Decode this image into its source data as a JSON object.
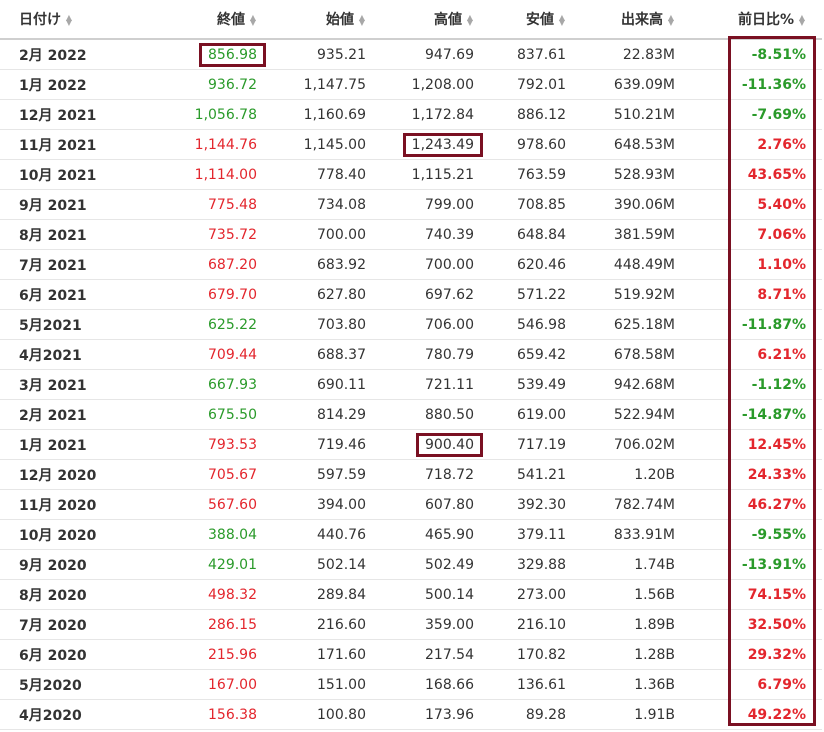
{
  "table": {
    "headers": {
      "date": "日付け",
      "close": "終値",
      "open": "始値",
      "high": "高値",
      "low": "安値",
      "volume": "出来高",
      "change": "前日比%"
    },
    "rows": [
      {
        "date": "2月 2022",
        "close": "856.98",
        "open": "935.21",
        "high": "947.69",
        "low": "837.61",
        "volume": "22.83M",
        "change": "-8.51%",
        "dir": "down"
      },
      {
        "date": "1月 2022",
        "close": "936.72",
        "open": "1,147.75",
        "high": "1,208.00",
        "low": "792.01",
        "volume": "639.09M",
        "change": "-11.36%",
        "dir": "down"
      },
      {
        "date": "12月 2021",
        "close": "1,056.78",
        "open": "1,160.69",
        "high": "1,172.84",
        "low": "886.12",
        "volume": "510.21M",
        "change": "-7.69%",
        "dir": "down"
      },
      {
        "date": "11月 2021",
        "close": "1,144.76",
        "open": "1,145.00",
        "high": "1,243.49",
        "low": "978.60",
        "volume": "648.53M",
        "change": "2.76%",
        "dir": "up"
      },
      {
        "date": "10月 2021",
        "close": "1,114.00",
        "open": "778.40",
        "high": "1,115.21",
        "low": "763.59",
        "volume": "528.93M",
        "change": "43.65%",
        "dir": "up"
      },
      {
        "date": "9月 2021",
        "close": "775.48",
        "open": "734.08",
        "high": "799.00",
        "low": "708.85",
        "volume": "390.06M",
        "change": "5.40%",
        "dir": "up"
      },
      {
        "date": "8月 2021",
        "close": "735.72",
        "open": "700.00",
        "high": "740.39",
        "low": "648.84",
        "volume": "381.59M",
        "change": "7.06%",
        "dir": "up"
      },
      {
        "date": "7月 2021",
        "close": "687.20",
        "open": "683.92",
        "high": "700.00",
        "low": "620.46",
        "volume": "448.49M",
        "change": "1.10%",
        "dir": "up"
      },
      {
        "date": "6月 2021",
        "close": "679.70",
        "open": "627.80",
        "high": "697.62",
        "low": "571.22",
        "volume": "519.92M",
        "change": "8.71%",
        "dir": "up"
      },
      {
        "date": "5月2021",
        "close": "625.22",
        "open": "703.80",
        "high": "706.00",
        "low": "546.98",
        "volume": "625.18M",
        "change": "-11.87%",
        "dir": "down"
      },
      {
        "date": "4月2021",
        "close": "709.44",
        "open": "688.37",
        "high": "780.79",
        "low": "659.42",
        "volume": "678.58M",
        "change": "6.21%",
        "dir": "up"
      },
      {
        "date": "3月 2021",
        "close": "667.93",
        "open": "690.11",
        "high": "721.11",
        "low": "539.49",
        "volume": "942.68M",
        "change": "-1.12%",
        "dir": "down"
      },
      {
        "date": "2月 2021",
        "close": "675.50",
        "open": "814.29",
        "high": "880.50",
        "low": "619.00",
        "volume": "522.94M",
        "change": "-14.87%",
        "dir": "down"
      },
      {
        "date": "1月 2021",
        "close": "793.53",
        "open": "719.46",
        "high": "900.40",
        "low": "717.19",
        "volume": "706.02M",
        "change": "12.45%",
        "dir": "up"
      },
      {
        "date": "12月 2020",
        "close": "705.67",
        "open": "597.59",
        "high": "718.72",
        "low": "541.21",
        "volume": "1.20B",
        "change": "24.33%",
        "dir": "up"
      },
      {
        "date": "11月 2020",
        "close": "567.60",
        "open": "394.00",
        "high": "607.80",
        "low": "392.30",
        "volume": "782.74M",
        "change": "46.27%",
        "dir": "up"
      },
      {
        "date": "10月 2020",
        "close": "388.04",
        "open": "440.76",
        "high": "465.90",
        "low": "379.11",
        "volume": "833.91M",
        "change": "-9.55%",
        "dir": "down"
      },
      {
        "date": "9月 2020",
        "close": "429.01",
        "open": "502.14",
        "high": "502.49",
        "low": "329.88",
        "volume": "1.74B",
        "change": "-13.91%",
        "dir": "down"
      },
      {
        "date": "8月 2020",
        "close": "498.32",
        "open": "289.84",
        "high": "500.14",
        "low": "273.00",
        "volume": "1.56B",
        "change": "74.15%",
        "dir": "up"
      },
      {
        "date": "7月 2020",
        "close": "286.15",
        "open": "216.60",
        "high": "359.00",
        "low": "216.10",
        "volume": "1.89B",
        "change": "32.50%",
        "dir": "up"
      },
      {
        "date": "6月 2020",
        "close": "215.96",
        "open": "171.60",
        "high": "217.54",
        "low": "170.82",
        "volume": "1.28B",
        "change": "29.32%",
        "dir": "up"
      },
      {
        "date": "5月2020",
        "close": "167.00",
        "open": "151.00",
        "high": "168.66",
        "low": "136.61",
        "volume": "1.36B",
        "change": "6.79%",
        "dir": "up"
      },
      {
        "date": "4月2020",
        "close": "156.38",
        "open": "100.80",
        "high": "173.96",
        "low": "89.28",
        "volume": "1.91B",
        "change": "49.22%",
        "dir": "up"
      }
    ]
  },
  "highlights": {
    "boxed_cells": [
      {
        "row": 0,
        "column": "close"
      },
      {
        "row": 3,
        "column": "high"
      },
      {
        "row": 13,
        "column": "high"
      }
    ],
    "boxed_column": "change",
    "box_color": "#7a1022"
  },
  "colors": {
    "up": "#e3262d",
    "down": "#2a9a2a",
    "text": "#333333",
    "sort_icon": "#a8a8a8"
  },
  "icons": {
    "sort": "sort-up-down-icon"
  }
}
